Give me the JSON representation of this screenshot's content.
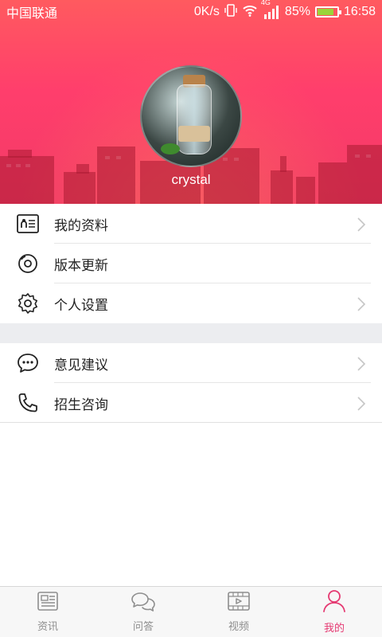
{
  "status_bar": {
    "carrier": "中国联通",
    "speed": "0K/s",
    "network": "4G",
    "battery": "85%",
    "battery_level": 0.85,
    "time": "16:58"
  },
  "profile": {
    "username": "crystal"
  },
  "menu": {
    "group1": [
      {
        "label": "我的资料",
        "icon": "profile-card-icon",
        "chevron": true
      },
      {
        "label": "版本更新",
        "icon": "update-disc-icon",
        "chevron": false
      },
      {
        "label": "个人设置",
        "icon": "gear-icon",
        "chevron": true
      }
    ],
    "group2": [
      {
        "label": "意见建议",
        "icon": "chat-bubble-icon",
        "chevron": true
      },
      {
        "label": "招生咨询",
        "icon": "phone-icon",
        "chevron": true
      }
    ]
  },
  "tabs": [
    {
      "label": "资讯",
      "icon": "news-icon",
      "active": false
    },
    {
      "label": "问答",
      "icon": "qa-icon",
      "active": false
    },
    {
      "label": "视频",
      "icon": "video-icon",
      "active": false
    },
    {
      "label": "我的",
      "icon": "person-icon",
      "active": true
    }
  ],
  "colors": {
    "accent": "#e53a72",
    "header_gradient_top": "#ff5a5f",
    "header_gradient_bottom": "#f23a66"
  }
}
